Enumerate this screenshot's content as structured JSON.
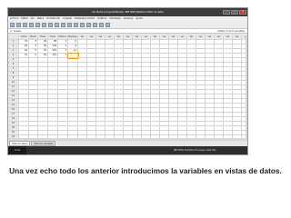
{
  "window": {
    "title": "Sin título1 [ConjuntoDatos0] - IBM SPSS Statistics Editor de datos",
    "min": "–",
    "max": "□",
    "close": "×"
  },
  "menu": [
    "Archivo",
    "Editar",
    "Ver",
    "Datos",
    "Transformar",
    "Analizar",
    "Marketing directo",
    "Gráficos",
    "Utilidades",
    "Ventana",
    "Ayuda"
  ],
  "toolbar_icons": [
    "open-icon",
    "save-icon",
    "print-icon",
    "dialog-recall-icon",
    "undo-icon",
    "redo-icon",
    "goto-case-icon",
    "goto-variable-icon",
    "variables-icon",
    "find-icon",
    "insert-cases-icon",
    "insert-variable-icon",
    "split-file-icon",
    "weight-cases-icon",
    "select-cases-icon",
    "value-labels-icon"
  ],
  "refbar": {
    "cell": "4 : Fresas",
    "visible": "Visible: 6 de 6 variables"
  },
  "columns": [
    "Lotes",
    "Manzi",
    "Fresa",
    "Uvas",
    "Platano",
    "Naranja"
  ],
  "var_placeholder": "var",
  "rows": [
    [
      "34",
      "3",
      "28",
      "98",
      "3",
      "0"
    ],
    [
      "26",
      "3",
      "19",
      "103",
      "3",
      "9"
    ],
    [
      "44",
      "5",
      "19",
      "119",
      "3",
      "11"
    ],
    [
      "31",
      "5",
      "18",
      "113",
      "3",
      ""
    ]
  ],
  "row_count": 22,
  "tabs": [
    "Vista de datos",
    "Vista de variables"
  ],
  "status": {
    "start": "Inicio",
    "processor": "IBM SPSS Statistics Processor está listo"
  },
  "caption": "Una vez echo todo los anterior introducimos la variables en vistas de datos."
}
